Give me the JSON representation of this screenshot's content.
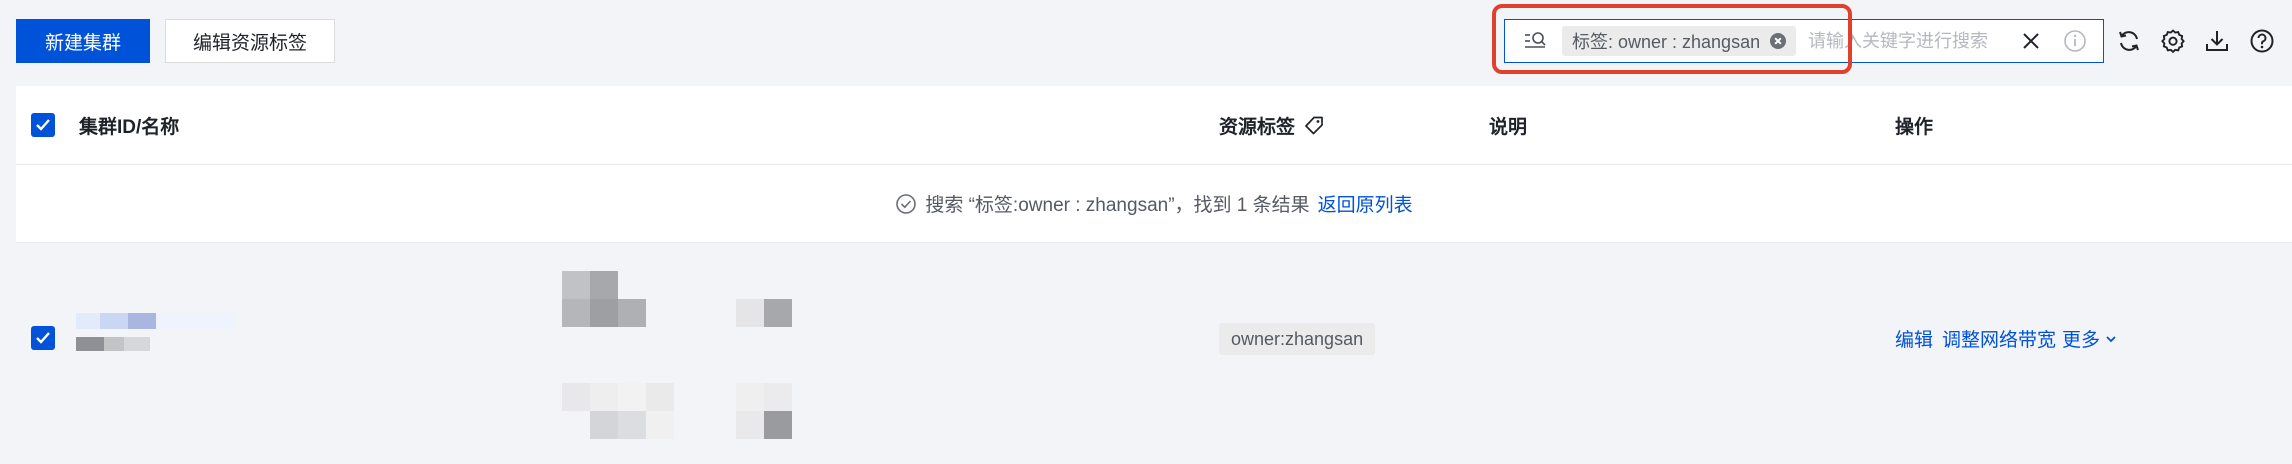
{
  "toolbar": {
    "create_cluster_label": "新建集群",
    "edit_tags_label": "编辑资源标签"
  },
  "search": {
    "tag_chip_text": "标签: owner : zhangsan",
    "placeholder": "请输入关键字进行搜索"
  },
  "table": {
    "columns": {
      "cluster_id_name": "集群ID/名称",
      "resource_tags": "资源标签",
      "description": "说明",
      "actions": "操作"
    },
    "search_result": {
      "message": "搜索 “标签:owner : zhangsan”，找到 1 条结果",
      "back_link": "返回原列表"
    },
    "rows": [
      {
        "tag": "owner:zhangsan",
        "actions": {
          "edit": "编辑",
          "adjust_bandwidth": "调整网络带宽",
          "more": "更多"
        }
      }
    ]
  },
  "colors": {
    "primary": "#0052d9",
    "highlight": "#e0402c"
  },
  "icons": [
    "filter-search-icon",
    "chip-close-icon",
    "clear-icon",
    "info-icon",
    "refresh-icon",
    "settings-icon",
    "download-icon",
    "help-icon",
    "tag-icon",
    "check-circle-icon",
    "chevron-down-icon"
  ]
}
